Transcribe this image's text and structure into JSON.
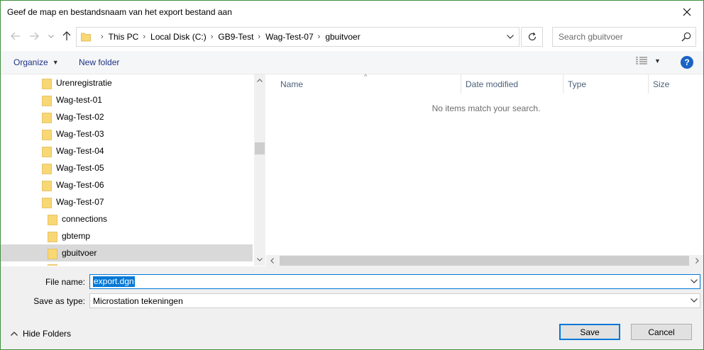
{
  "window": {
    "title": "Geef de map en bestandsnaam van het export bestand aan"
  },
  "nav": {
    "breadcrumbs": [
      "This PC",
      "Local Disk (C:)",
      "GB9-Test",
      "Wag-Test-07",
      "gbuitvoer"
    ],
    "search_placeholder": "Search gbuitvoer"
  },
  "toolbar": {
    "organize_label": "Organize",
    "new_folder_label": "New folder",
    "help_label": "?"
  },
  "tree": {
    "items": [
      {
        "label": "Urenregistratie",
        "level": 1,
        "selected": false
      },
      {
        "label": "Wag-test-01",
        "level": 1,
        "selected": false
      },
      {
        "label": "Wag-Test-02",
        "level": 1,
        "selected": false
      },
      {
        "label": "Wag-Test-03",
        "level": 1,
        "selected": false
      },
      {
        "label": "Wag-Test-04",
        "level": 1,
        "selected": false
      },
      {
        "label": "Wag-Test-05",
        "level": 1,
        "selected": false
      },
      {
        "label": "Wag-Test-06",
        "level": 1,
        "selected": false
      },
      {
        "label": "Wag-Test-07",
        "level": 1,
        "selected": false
      },
      {
        "label": "connections",
        "level": 2,
        "selected": false
      },
      {
        "label": "gbtemp",
        "level": 2,
        "selected": false
      },
      {
        "label": "gbuitvoer",
        "level": 2,
        "selected": true
      }
    ]
  },
  "filelist": {
    "columns": [
      "Name",
      "Date modified",
      "Type",
      "Size"
    ],
    "empty_message": "No items match your search."
  },
  "footer": {
    "file_name_label": "File name:",
    "file_name_value": "export.dgn",
    "save_type_label": "Save as type:",
    "save_type_value": "Microstation tekeningen",
    "hide_folders_label": "Hide Folders",
    "save_label": "Save",
    "cancel_label": "Cancel"
  },
  "colors": {
    "accent": "#0078d7",
    "folder": "#f8d775",
    "selected_row": "#d9d9d9",
    "link": "#1e3287"
  }
}
